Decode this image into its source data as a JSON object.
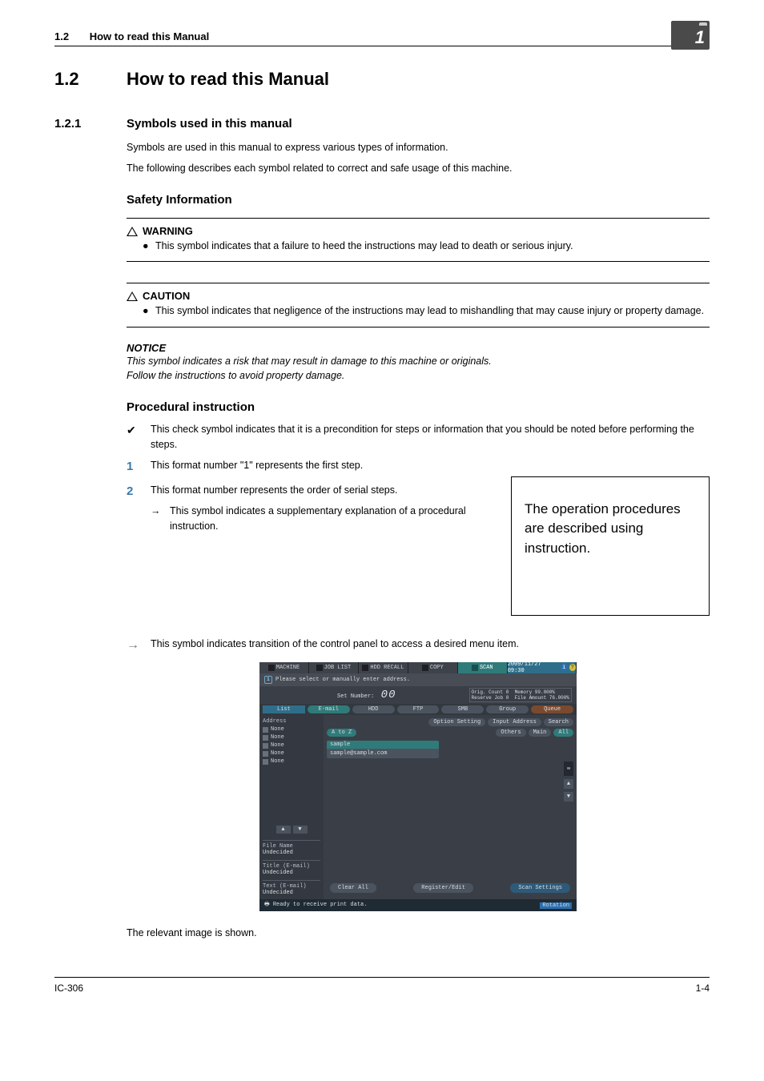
{
  "header": {
    "secnum": "1.2",
    "title": "How to read this Manual"
  },
  "corner": "1",
  "h1": {
    "num": "1.2",
    "title": "How to read this Manual"
  },
  "h2": {
    "num": "1.2.1",
    "title": "Symbols used in this manual"
  },
  "intro": {
    "p1": "Symbols are used in this manual to express various types of information.",
    "p2": "The following describes each symbol related to correct and safe usage of this machine."
  },
  "safety": {
    "heading": "Safety Information",
    "warning": {
      "label": "WARNING",
      "item": "This symbol indicates that a failure to heed the instructions may lead to death or serious injury."
    },
    "caution": {
      "label": "CAUTION",
      "item": "This symbol indicates that negligence of the instructions may lead to mishandling that may cause injury or property damage."
    },
    "notice": {
      "label": "NOTICE",
      "l1": "This symbol indicates a risk that may result in damage to this machine or originals.",
      "l2": "Follow the instructions to avoid property damage."
    }
  },
  "proc": {
    "heading": "Procedural instruction",
    "check": "This check symbol indicates that it is a precondition for steps or information that you should be noted before performing the steps.",
    "s1": "This format number \"1\" represents the first step.",
    "s2": "This format number represents the order of serial steps.",
    "sub": "This symbol indicates a supplementary explanation of a procedural instruction.",
    "callout": "The operation procedures are described using instruction.",
    "trans": "This symbol indicates transition of the control panel to access a desired menu item."
  },
  "panel": {
    "tabs": {
      "machine": "MACHINE",
      "joblist": "JOB LIST",
      "recall": "HDD RECALL",
      "copy": "COPY",
      "scan": "SCAN",
      "time": "2009/11/27 09:30"
    },
    "msg": "Please select or manually enter address.",
    "setnum_label": "Set Number:",
    "setnum_val": "00",
    "counts": {
      "orig": "Orig. Count",
      "orig_v": "0",
      "mem": "Memory",
      "mem_v": "99.000%",
      "res": "Reserve Job",
      "res_v": "0",
      "file": "File Amount",
      "file_v": "76.000%"
    },
    "chips": {
      "list": "List",
      "email": "E-mail",
      "hdd": "HDD",
      "ftp": "FTP",
      "smb": "SMB",
      "group": "Group",
      "queue": "Queue"
    },
    "btns": {
      "option": "Option Setting",
      "input": "Input Address",
      "search": "Search",
      "atoz": "A to Z",
      "others": "Others",
      "main": "Main",
      "all": "All"
    },
    "card": {
      "name": "sample",
      "addr": "sample@sample.com"
    },
    "side": {
      "address": "Address",
      "none": "None",
      "filename": "File Name",
      "undecided": "Undecided",
      "titlee": "Title (E-mail)",
      "texte": "Text (E-mail)"
    },
    "footer": {
      "clear": "Clear All",
      "reg": "Register/Edit",
      "scan": "Scan Settings"
    },
    "status": {
      "ready": "Ready to receive print data.",
      "rot": "Rotation"
    }
  },
  "caption": "The relevant image is shown.",
  "footer": {
    "left": "IC-306",
    "right": "1-4"
  }
}
